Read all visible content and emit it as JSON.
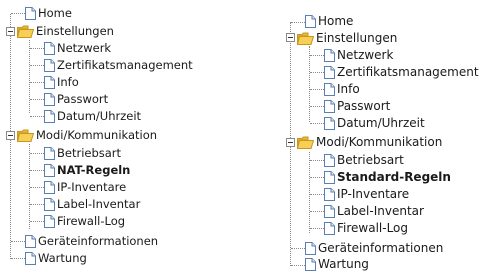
{
  "left_tree": {
    "home": "Home",
    "einstellungen": "Einstellungen",
    "netzwerk": "Netzwerk",
    "zertifikatsmanagement": "Zertifikatsmanagement",
    "info": "Info",
    "passwort": "Passwort",
    "datum_uhrzeit": "Datum/Uhrzeit",
    "modi_kommunikation": "Modi/Kommunikation",
    "betriebsart": "Betriebsart",
    "nat_regeln": "NAT-Regeln",
    "ip_inventare": "IP-Inventare",
    "label_inventar": "Label-Inventar",
    "firewall_log": "Firewall-Log",
    "geraeteinformationen": "Geräteinformationen",
    "wartung": "Wartung"
  },
  "right_tree": {
    "home": "Home",
    "einstellungen": "Einstellungen",
    "netzwerk": "Netzwerk",
    "zertifikatsmanagement": "Zertifikatsmanagement",
    "info": "Info",
    "passwort": "Passwort",
    "datum_uhrzeit": "Datum/Uhrzeit",
    "modi_kommunikation": "Modi/Kommunikation",
    "betriebsart": "Betriebsart",
    "standard_regeln": "Standard-Regeln",
    "ip_inventare": "IP-Inventare",
    "label_inventar": "Label-Inventar",
    "firewall_log": "Firewall-Log",
    "geraeteinformationen": "Geräteinformationen",
    "wartung": "Wartung"
  },
  "icons": {
    "document": "document-icon",
    "folder_open": "folder-open-icon",
    "collapse_toggle": "minus-toggle-icon"
  },
  "colors": {
    "doc_border": "#5b7fb0",
    "doc_fill": "#ffffff",
    "folder_fill": "#f6cf55",
    "folder_border": "#c9961f",
    "tree_lines": "#8a8a8a"
  }
}
